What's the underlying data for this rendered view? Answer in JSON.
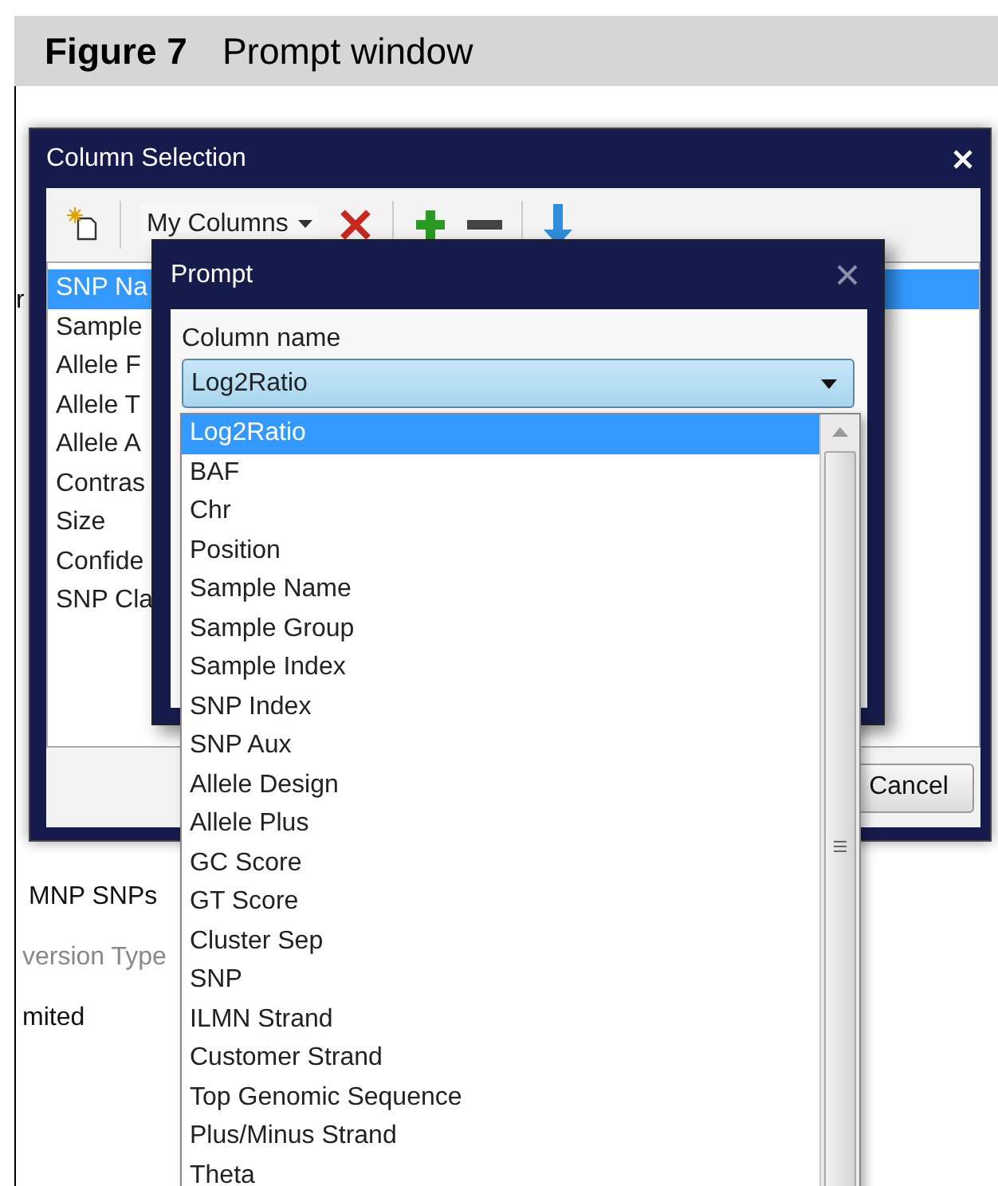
{
  "figure": {
    "label": "Figure 7",
    "title": "Prompt window"
  },
  "background_texts": [
    {
      "text": "r",
      "disabled": false
    },
    {
      "text": "MNP SNPs",
      "disabled": false
    },
    {
      "text": "version Type",
      "disabled": true
    },
    {
      "text": "mited",
      "disabled": false
    }
  ],
  "column_selection": {
    "title": "Column Selection",
    "preset": "My Columns",
    "columns": [
      {
        "label": "SNP Na",
        "selected": true
      },
      {
        "label": "Sample",
        "selected": false
      },
      {
        "label": "Allele F",
        "selected": false
      },
      {
        "label": "Allele T",
        "selected": false
      },
      {
        "label": "Allele A",
        "selected": false
      },
      {
        "label": "Contras",
        "selected": false
      },
      {
        "label": "Size",
        "selected": false
      },
      {
        "label": "Confide",
        "selected": false
      },
      {
        "label": "SNP Cla",
        "selected": false
      }
    ],
    "buttons": [
      "Cancel"
    ]
  },
  "prompt": {
    "title": "Prompt",
    "field_label": "Column name",
    "value": "Log2Ratio",
    "options": [
      {
        "label": "Log2Ratio",
        "selected": true
      },
      {
        "label": "BAF",
        "selected": false
      },
      {
        "label": "Chr",
        "selected": false
      },
      {
        "label": "Position",
        "selected": false
      },
      {
        "label": "Sample Name",
        "selected": false
      },
      {
        "label": "Sample Group",
        "selected": false
      },
      {
        "label": "Sample Index",
        "selected": false
      },
      {
        "label": "SNP Index",
        "selected": false
      },
      {
        "label": "SNP Aux",
        "selected": false
      },
      {
        "label": "Allele Design",
        "selected": false
      },
      {
        "label": "Allele Plus",
        "selected": false
      },
      {
        "label": "GC Score",
        "selected": false
      },
      {
        "label": "GT Score",
        "selected": false
      },
      {
        "label": "Cluster Sep",
        "selected": false
      },
      {
        "label": "SNP",
        "selected": false
      },
      {
        "label": "ILMN Strand",
        "selected": false
      },
      {
        "label": "Customer Strand",
        "selected": false
      },
      {
        "label": "Top Genomic Sequence",
        "selected": false
      },
      {
        "label": "Plus/Minus Strand",
        "selected": false
      },
      {
        "label": "Theta",
        "selected": false
      }
    ]
  }
}
